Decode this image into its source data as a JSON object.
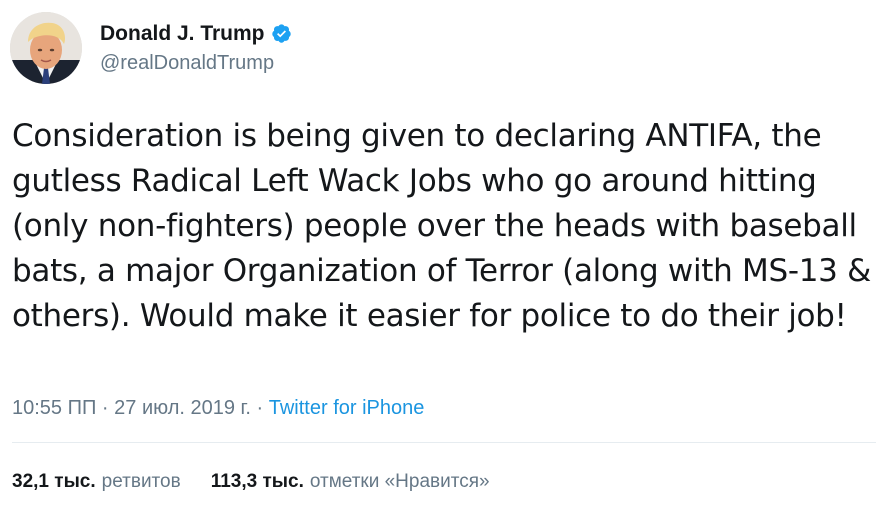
{
  "author": {
    "display_name": "Donald J. Trump",
    "handle": "@realDonaldTrump",
    "verified": true,
    "avatar_icon": "profile-photo"
  },
  "tweet": {
    "text": "Consideration is being given to declaring ANTIFA, the gutless Radical Left Wack Jobs who go around hitting (only non-fighters) people over the heads with baseball bats, a major Organization of Terror (along with MS-13 & others). Would make it easier for police to do their job!",
    "time": "10:55 ПП",
    "separator": "·",
    "date": "27 июл. 2019 г.",
    "source": "Twitter for iPhone"
  },
  "stats": {
    "retweets_count": "32,1 тыс.",
    "retweets_label": "ретвитов",
    "likes_count": "113,3 тыс.",
    "likes_label": "отметки «Нравится»"
  },
  "colors": {
    "text": "#14171a",
    "secondary": "#657786",
    "link": "#1b95e0",
    "verified": "#1da1f2",
    "divider": "#e6ecf0"
  }
}
